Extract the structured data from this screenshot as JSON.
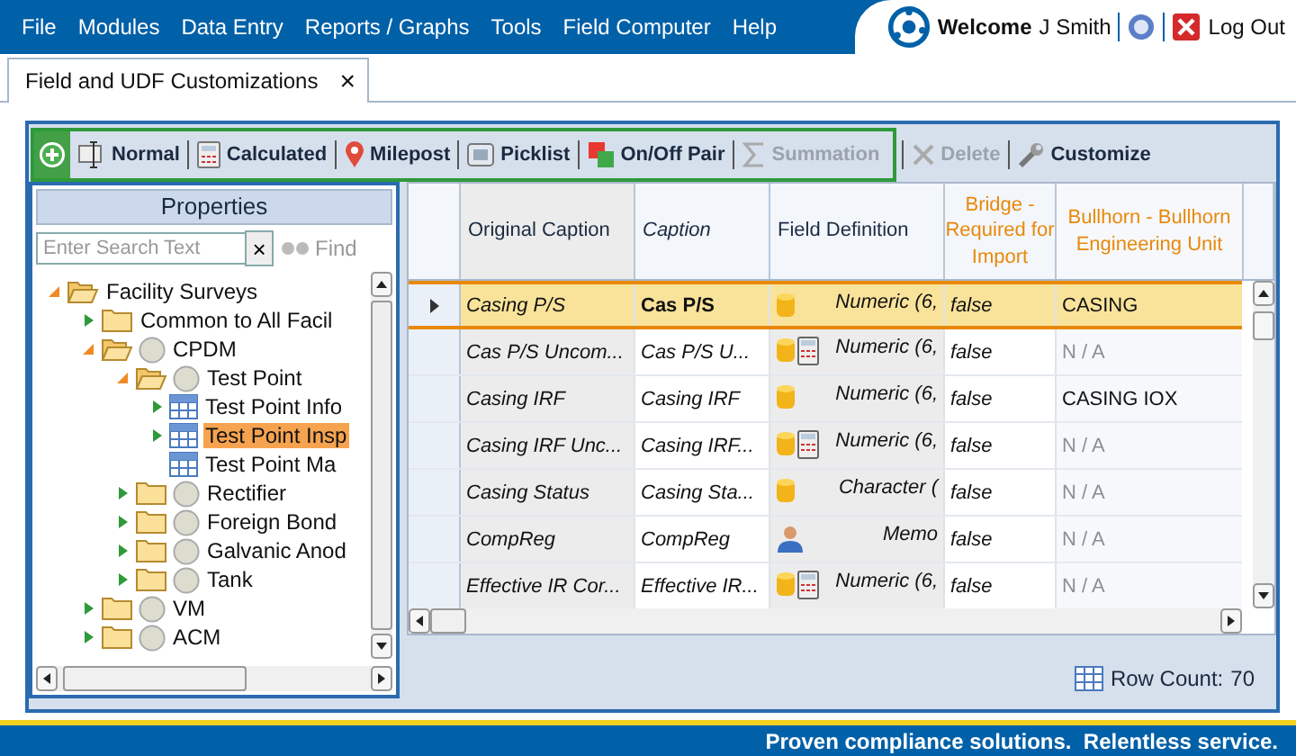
{
  "menu": [
    "File",
    "Modules",
    "Data Entry",
    "Reports / Graphs",
    "Tools",
    "Field Computer",
    "Help"
  ],
  "user": {
    "welcome": "Welcome",
    "name": "J Smith",
    "logout": "Log Out"
  },
  "tabs": [
    {
      "label": "Field and UDF Customizations",
      "selected": true,
      "close": "×"
    }
  ],
  "toolbar": {
    "group": [
      {
        "kind": "add",
        "disabled": false
      },
      {
        "kind": "normal",
        "label": "Normal",
        "disabled": false
      },
      {
        "kind": "calculated",
        "label": "Calculated",
        "disabled": false
      },
      {
        "kind": "milepost",
        "label": "Milepost",
        "disabled": false
      },
      {
        "kind": "picklist",
        "label": "Picklist",
        "disabled": false
      },
      {
        "kind": "onoff",
        "label": "On/Off Pair",
        "disabled": false
      },
      {
        "kind": "summation",
        "label": "Summation",
        "disabled": true
      }
    ],
    "extra": [
      {
        "kind": "delete",
        "label": "Delete",
        "disabled": true
      },
      {
        "kind": "customize",
        "label": "Customize",
        "disabled": false
      }
    ]
  },
  "properties": {
    "title": "Properties",
    "search": {
      "placeholder": "Enter Search Text",
      "clear": "×"
    },
    "find": {
      "label": "Find",
      "disabled": true
    },
    "tree": [
      {
        "label": "Facility Surveys",
        "kind": "folder",
        "expanded": true,
        "selected": false,
        "children": [
          {
            "label": "Common to All Facil",
            "kind": "folder",
            "expanded": false,
            "selected": false
          },
          {
            "label": "CPDM",
            "kind": "node",
            "expanded": true,
            "selected": false,
            "children": [
              {
                "label": "Test Point",
                "kind": "node",
                "expanded": true,
                "selected": false,
                "children": [
                  {
                    "label": "Test Point Info",
                    "kind": "table",
                    "expanded": false,
                    "selected": false
                  },
                  {
                    "label": "Test Point Insp",
                    "kind": "table",
                    "expanded": false,
                    "selected": true
                  },
                  {
                    "label": "Test Point Ma",
                    "kind": "table",
                    "selected": false
                  }
                ]
              },
              {
                "label": "Rectifier",
                "kind": "node",
                "expanded": false,
                "selected": false
              },
              {
                "label": "Foreign Bond",
                "kind": "node",
                "expanded": false,
                "selected": false
              },
              {
                "label": "Galvanic Anod",
                "kind": "node",
                "expanded": false,
                "selected": false
              },
              {
                "label": "Tank",
                "kind": "node",
                "expanded": false,
                "selected": false
              }
            ]
          },
          {
            "label": "VM",
            "kind": "node",
            "expanded": false,
            "selected": false
          },
          {
            "label": "ACM",
            "kind": "node",
            "expanded": false,
            "selected": false
          }
        ]
      }
    ]
  },
  "table": {
    "columns": [
      {
        "label": "Original Caption",
        "highlighted": false
      },
      {
        "label": "Caption",
        "highlighted": false
      },
      {
        "label": "Field Definition",
        "highlighted": false
      },
      {
        "label": "Bridge - Required for Import",
        "highlighted": true
      },
      {
        "label": "Bullhorn - Bullhorn Engineering Unit",
        "highlighted": true
      }
    ],
    "rows": [
      {
        "selected": true,
        "original": "Casing P/S",
        "caption": "Cas P/S",
        "kind": "stored",
        "definition": "Numeric (6,",
        "bridge": "false",
        "bullhorn": {
          "text": "CASING",
          "disabled": false
        }
      },
      {
        "selected": false,
        "original": "Cas P/S Uncom...",
        "caption": "Cas P/S U...",
        "kind": "calculated",
        "definition": "Numeric (6,",
        "bridge": "false",
        "bullhorn": {
          "text": "N / A",
          "disabled": true
        }
      },
      {
        "selected": false,
        "original": "Casing IRF",
        "caption": "Casing IRF",
        "kind": "stored",
        "definition": "Numeric (6,",
        "bridge": "false",
        "bullhorn": {
          "text": "CASING IOX",
          "disabled": false
        }
      },
      {
        "selected": false,
        "original": "Casing IRF Unc...",
        "caption": "Casing IRF...",
        "kind": "calculated",
        "definition": "Numeric (6,",
        "bridge": "false",
        "bullhorn": {
          "text": "N / A",
          "disabled": true
        }
      },
      {
        "selected": false,
        "original": "Casing Status",
        "caption": "Casing Sta...",
        "kind": "stored",
        "definition": "Character (",
        "bridge": "false",
        "bullhorn": {
          "text": "N / A",
          "disabled": true
        }
      },
      {
        "selected": false,
        "original": "CompReg",
        "caption": "CompReg",
        "kind": "user",
        "definition": "Memo",
        "bridge": "false",
        "bullhorn": {
          "text": "N / A",
          "disabled": true
        }
      },
      {
        "selected": false,
        "original": "Effective IR Cor...",
        "caption": "Effective IR...",
        "kind": "calculated",
        "definition": "Numeric (6,",
        "bridge": "false",
        "bullhorn": {
          "text": "N / A",
          "disabled": true
        }
      }
    ],
    "row_count": {
      "label": "Row Count:",
      "value": "70"
    }
  },
  "footer": "Proven compliance solutions.  Relentless service."
}
